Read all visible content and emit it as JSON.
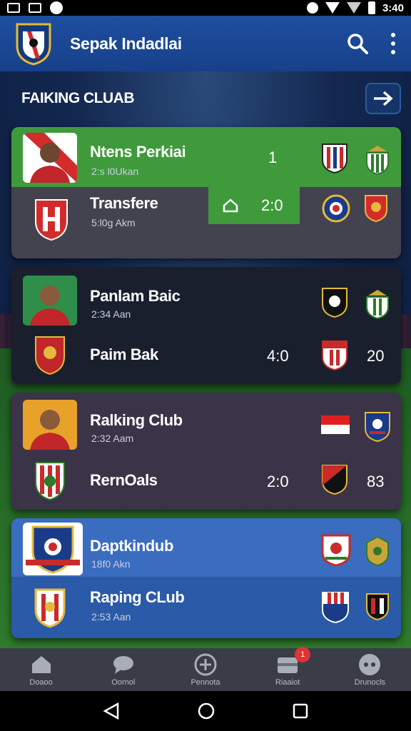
{
  "status_bar": {
    "time": "3:40"
  },
  "app_bar": {
    "title": "Sepak Indadlai"
  },
  "section": {
    "title": "FAIKING CLUAB"
  },
  "cards": [
    {
      "theme": "green",
      "top": {
        "name": "Ntens Perkiai",
        "time": "2:s l0Ukan",
        "score": "1"
      },
      "bottom": {
        "name": "Transfere",
        "time": "5:l0g Akm",
        "score": "2:0"
      }
    },
    {
      "theme": "dark",
      "top": {
        "name": "Panlam Baic",
        "time": "2:34 Aan"
      },
      "bottom": {
        "name": "Paim Bak",
        "score": "4:0",
        "right": "20"
      }
    },
    {
      "theme": "purple",
      "top": {
        "name": "Ralking Club",
        "time": "2:32 Aam"
      },
      "bottom": {
        "name": "RernOals",
        "score": "2:0",
        "right": "83"
      }
    },
    {
      "theme": "blue",
      "top": {
        "name": "Daptkindub",
        "time": "18f0 Akn"
      },
      "bottom": {
        "name": "Raping CLub",
        "time": "2:53 Aan"
      }
    }
  ],
  "bottom_nav": [
    {
      "label": "Doaoo",
      "icon": "home-icon"
    },
    {
      "label": "Oornol",
      "icon": "chat-icon"
    },
    {
      "label": "Pennota",
      "icon": "add-circle-icon"
    },
    {
      "label": "Riaaiot",
      "icon": "inbox-icon",
      "badge": "1"
    },
    {
      "label": "Drunocls",
      "icon": "more-circle-icon"
    }
  ],
  "colors": {
    "app_bar": "#1e4fa0",
    "card_green": "#3f9a3c",
    "card_dark": "#1a1f2e",
    "card_purple": "#3b3348",
    "card_blue": "#2a5aa8",
    "badge": "#e23232"
  }
}
